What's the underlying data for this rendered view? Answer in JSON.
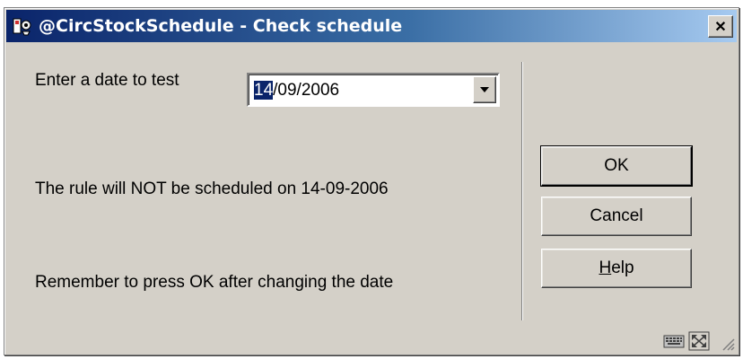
{
  "window": {
    "title": "@CircStockSchedule - Check schedule",
    "close_glyph": "✕"
  },
  "form": {
    "date_label": "Enter a date to test",
    "date_value_selected": "14",
    "date_value_rest": "/09/2006",
    "result_text": "The rule will NOT be scheduled on 14-09-2006",
    "hint_text": "Remember to press OK after changing the date"
  },
  "buttons": {
    "ok": "OK",
    "cancel": "Cancel",
    "help_mnemonic": "H",
    "help_rest": "elp"
  },
  "icons": {
    "app": "app-icon",
    "dropdown": "chevron-down-icon",
    "status_left": "keyboard-icon",
    "status_right": "resize-icon"
  }
}
